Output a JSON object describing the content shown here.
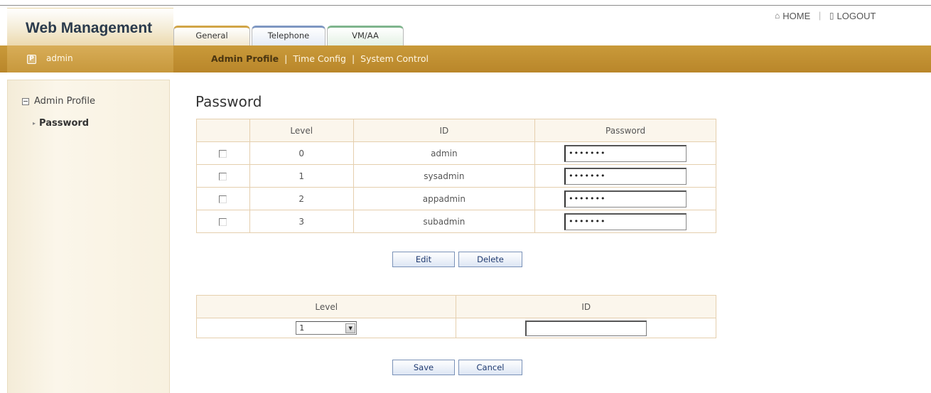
{
  "header": {
    "brand": "Web Management",
    "tabs": [
      {
        "label": "General"
      },
      {
        "label": "Telephone"
      },
      {
        "label": "VM/AA"
      }
    ],
    "home_label": "HOME",
    "logout_label": "LOGOUT",
    "home_icon": "home-icon",
    "logout_icon": "logout-icon"
  },
  "bar": {
    "user": "admin",
    "user_icon": "user-icon",
    "subnav": [
      {
        "label": "Admin Profile",
        "active": true
      },
      {
        "label": "Time Config"
      },
      {
        "label": "System Control"
      }
    ],
    "separator": "|"
  },
  "sidebar": {
    "root_label": "Admin Profile",
    "child_label": "Password"
  },
  "main": {
    "title": "Password",
    "table": {
      "headers": [
        "",
        "Level",
        "ID",
        "Password"
      ],
      "rows": [
        {
          "level": "0",
          "id": "admin",
          "password": "•••••••"
        },
        {
          "level": "1",
          "id": "sysadmin",
          "password": "•••••••"
        },
        {
          "level": "2",
          "id": "appadmin",
          "password": "•••••••"
        },
        {
          "level": "3",
          "id": "subadmin",
          "password": "•••••••"
        }
      ]
    },
    "edit_label": "Edit",
    "delete_label": "Delete",
    "add_table": {
      "headers": [
        "Level",
        "ID"
      ],
      "level_value": "1",
      "id_value": ""
    },
    "save_label": "Save",
    "cancel_label": "Cancel"
  },
  "colors": {
    "accent_bar": "#c2913a",
    "tab_general": "#d1a547",
    "tab_telephone": "#7e97c2",
    "tab_vmaa": "#7fb58d",
    "table_border": "#e5cfae"
  }
}
